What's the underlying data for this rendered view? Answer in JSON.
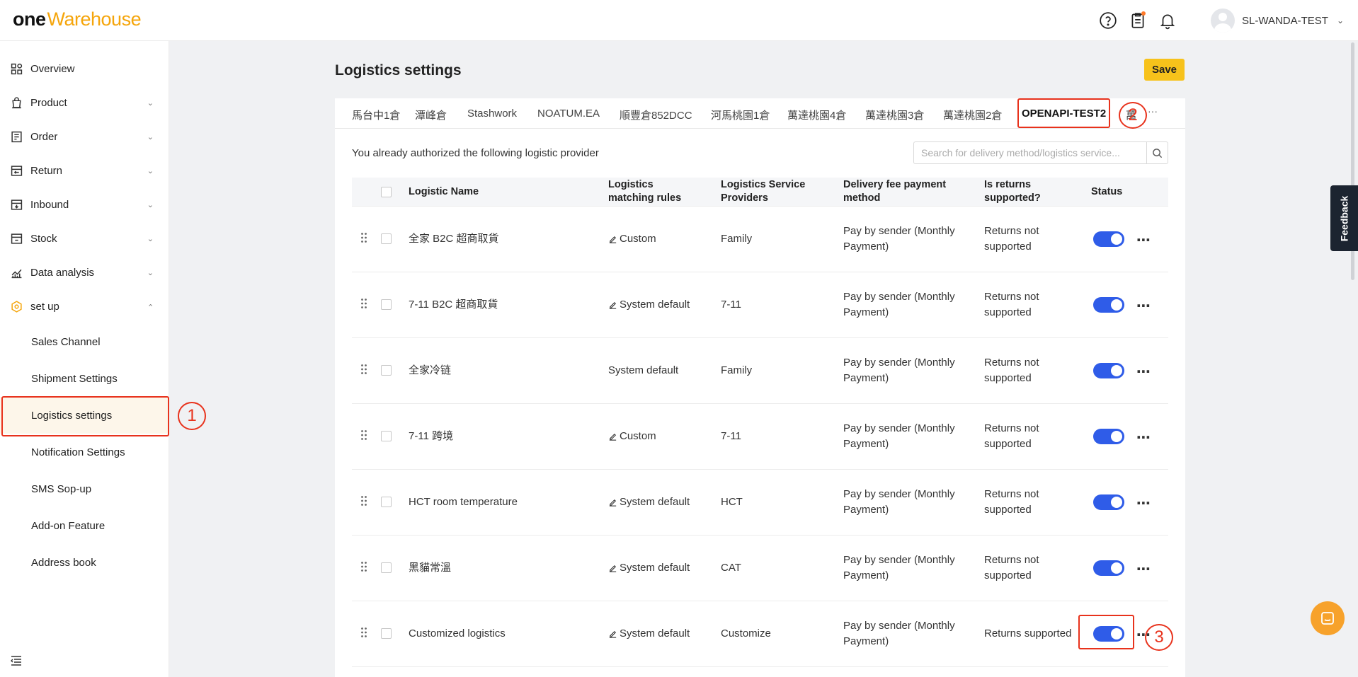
{
  "app": {
    "logo_one": "one",
    "logo_rest": "Warehouse"
  },
  "header": {
    "user_name": "SL-WANDA-TEST",
    "icons": [
      "help-circle-icon",
      "clipboard-icon",
      "bell-icon"
    ]
  },
  "sidebar": {
    "items": [
      {
        "label": "Overview",
        "icon": "dashboard-icon"
      },
      {
        "label": "Product",
        "icon": "product-icon"
      },
      {
        "label": "Order",
        "icon": "order-icon"
      },
      {
        "label": "Return",
        "icon": "return-icon"
      },
      {
        "label": "Inbound",
        "icon": "inbound-icon"
      },
      {
        "label": "Stock",
        "icon": "stock-icon"
      },
      {
        "label": "Data analysis",
        "icon": "chart-icon"
      },
      {
        "label": "set up",
        "icon": "settings-icon"
      }
    ],
    "sub_items": [
      {
        "label": "Sales Channel"
      },
      {
        "label": "Shipment Settings"
      },
      {
        "label": "Logistics settings"
      },
      {
        "label": "Notification Settings"
      },
      {
        "label": "SMS Sop-up"
      },
      {
        "label": "Add-on Feature"
      },
      {
        "label": "Address book"
      }
    ]
  },
  "page": {
    "title": "Logistics settings",
    "save_label": "Save"
  },
  "tabs": {
    "items": [
      "馬台中1倉",
      "潭峰倉",
      "Stashwork",
      "NOATUM.EA",
      "順豐倉852DCC",
      "河馬桃園1倉",
      "萬達桃園4倉",
      "萬達桃園3倉",
      "萬達桃園2倉",
      "OPENAPI-TEST2",
      "萬"
    ],
    "active": "OPENAPI-TEST2",
    "more": "···"
  },
  "authorized_text": "You already authorized the following logistic provider",
  "search": {
    "placeholder": "Search for delivery method/logistics service..."
  },
  "table": {
    "headers": {
      "name": "Logistic Name",
      "rules": "Logistics matching rules",
      "providers": "Logistics Service Providers",
      "payment": "Delivery fee payment method",
      "returns": "Is returns supported?",
      "status": "Status"
    },
    "rows": [
      {
        "name": "全家 B2C 超商取貨",
        "rule": "Custom",
        "rule_editable": true,
        "provider": "Family",
        "payment": "Pay by sender (Monthly Payment)",
        "returns": "Returns not supported",
        "status": true
      },
      {
        "name": "7-11 B2C 超商取貨",
        "rule": "System default",
        "rule_editable": true,
        "provider": "7-11",
        "payment": "Pay by sender (Monthly Payment)",
        "returns": "Returns not supported",
        "status": true
      },
      {
        "name": "全家冷链",
        "rule": "System default",
        "rule_editable": false,
        "provider": "Family",
        "payment": "Pay by sender (Monthly Payment)",
        "returns": "Returns not supported",
        "status": true
      },
      {
        "name": "7-11 跨境",
        "rule": "Custom",
        "rule_editable": true,
        "provider": "7-11",
        "payment": "Pay by sender (Monthly Payment)",
        "returns": "Returns not supported",
        "status": true
      },
      {
        "name": "HCT room temperature",
        "rule": "System default",
        "rule_editable": true,
        "provider": "HCT",
        "payment": "Pay by sender (Monthly Payment)",
        "returns": "Returns not supported",
        "status": true
      },
      {
        "name": "黑貓常溫",
        "rule": "System default",
        "rule_editable": true,
        "provider": "CAT",
        "payment": "Pay by sender (Monthly Payment)",
        "returns": "Returns not supported",
        "status": true
      },
      {
        "name": "Customized logistics",
        "rule": "System default",
        "rule_editable": true,
        "provider": "Customize",
        "payment": "Pay by sender (Monthly Payment)",
        "returns": "Returns supported",
        "status": true
      }
    ]
  },
  "annotations": [
    "1",
    "2",
    "3"
  ],
  "feedback_label": "Feedback",
  "colors": {
    "accent": "#f7c21b",
    "toggle_on": "#2f5ce8",
    "annotation": "#e8321c",
    "brand_orange": "#f5a50b"
  }
}
